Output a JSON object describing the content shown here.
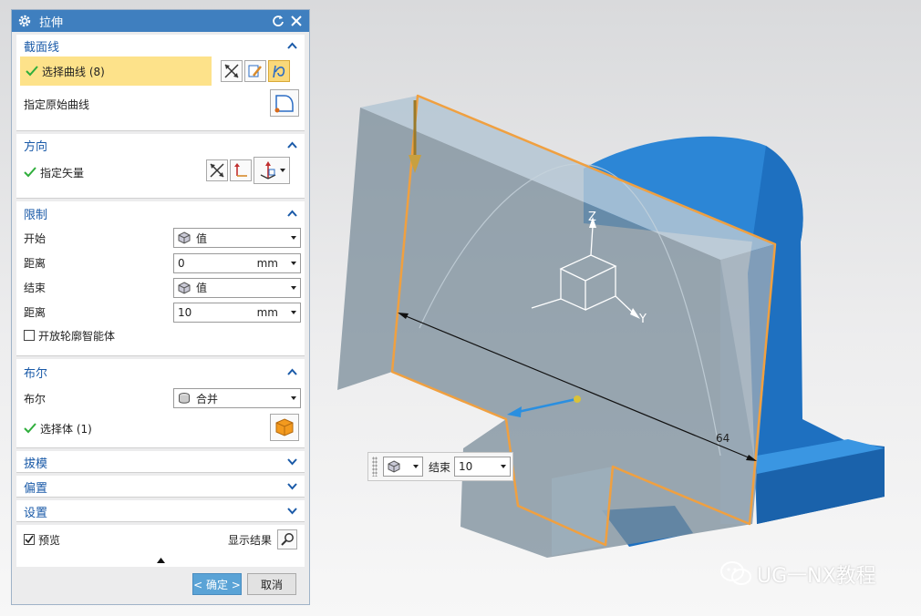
{
  "dialog": {
    "title": "拉伸",
    "section": {
      "section_title": "截面线",
      "select_curve": "选择曲线 (8)",
      "specify_original": "指定原始曲线"
    },
    "direction": {
      "title": "方向",
      "specify_vector": "指定矢量"
    },
    "limits": {
      "title": "限制",
      "start_label": "开始",
      "start_value": "值",
      "dist1_label": "距离",
      "dist1_value": "0",
      "dist1_unit": "mm",
      "end_label": "结束",
      "end_value": "值",
      "dist2_label": "距离",
      "dist2_value": "10",
      "dist2_unit": "mm",
      "open_profile": "开放轮廓智能体"
    },
    "boolean": {
      "title": "布尔",
      "label": "布尔",
      "value": "合并",
      "select_body": "选择体 (1)"
    },
    "draft": "拔模",
    "offset": "偏置",
    "settings": "设置",
    "preview_label": "预览",
    "show_result": "显示结果",
    "ok": "< 确定 >",
    "cancel": "取消"
  },
  "viewport": {
    "dimension_label": "64",
    "axis_z": "Z",
    "axis_y": "Y",
    "float_label": "结束",
    "float_value": "10"
  },
  "watermark": "UG一NX教程",
  "colors": {
    "title_bar": "#3f7fbf",
    "section_heading": "#1a5aa8",
    "highlight": "#fde28a",
    "solid_blue": "#1f78c8",
    "sketch_orange": "#f0a040"
  }
}
